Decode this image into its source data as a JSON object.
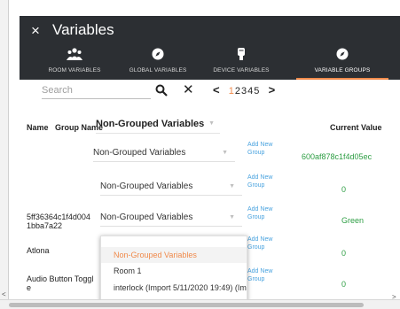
{
  "dialog": {
    "title": "Variables",
    "close_symbol": "×"
  },
  "tabs": [
    {
      "label": "ROOM VARIABLES",
      "icon": "people-icon",
      "active": false
    },
    {
      "label": "GLOBAL VARIABLES",
      "icon": "compass-icon",
      "active": false
    },
    {
      "label": "DEVICE VARIABLES",
      "icon": "device-icon",
      "active": false
    },
    {
      "label": "VARIABLE GROUPS",
      "icon": "compass-icon",
      "active": true
    }
  ],
  "search": {
    "placeholder": "Search",
    "clear_symbol": "✕"
  },
  "pager": {
    "prev": "<",
    "pages": [
      "1",
      "2",
      "3",
      "4",
      "5"
    ],
    "current": "1",
    "next": ">"
  },
  "table": {
    "headers": {
      "name": "Name",
      "group_name": "Group Name",
      "current_value": "Current Value"
    },
    "group_header_value": "Non-Grouped Variables",
    "add_group_label": "Add New Group",
    "rows": [
      {
        "name": "",
        "group": "Non-Grouped Variables",
        "value": "600af878c1f4d05ec"
      },
      {
        "name": "",
        "group": "Non-Grouped Variables",
        "value": "0"
      },
      {
        "name": "5ff36364c1f4d0041bba7a22",
        "group": "Non-Grouped Variables",
        "value": "Green"
      },
      {
        "name": "Atlona",
        "group": "",
        "value": "0"
      },
      {
        "name": "Audio Button Toggle",
        "group": "",
        "value": "0"
      }
    ]
  },
  "dropdown": {
    "options": [
      "Non-Grouped Variables",
      "Room 1",
      "interlock (Import 5/11/2020 19:49) (Im"
    ],
    "selected": "Non-Grouped Variables"
  },
  "colors": {
    "accent": "#f08a4b",
    "header_bg": "#2c2f33",
    "value_green": "#2e9e44",
    "link_blue": "#4aa3df"
  }
}
